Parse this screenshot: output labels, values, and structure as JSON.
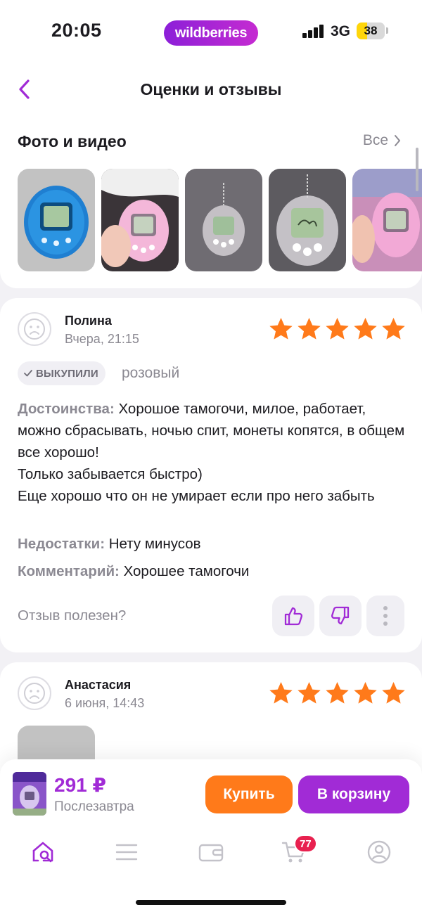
{
  "status_bar": {
    "time": "20:05",
    "brand": "wildberries",
    "network": "3G",
    "battery": "38",
    "battery_level": 0.38
  },
  "header": {
    "title": "Оценки и отзывы",
    "back_icon": "chevron-left-icon"
  },
  "photos": {
    "title": "Фото и видео",
    "all_label": "Все",
    "items": [
      {
        "alt": "blue tamagotchi",
        "color": "#2a7fc9"
      },
      {
        "alt": "pink tamagotchi in hand",
        "color": "#f2b5d6"
      },
      {
        "alt": "clear tamagotchi",
        "color": "#6e6c70"
      },
      {
        "alt": "clear tamagotchi closeup",
        "color": "#5c5a5e"
      },
      {
        "alt": "pink tamagotchi",
        "color": "#e9a6d2"
      }
    ]
  },
  "reviews": [
    {
      "author": "Полина",
      "date": "Вчера, 21:15",
      "rating": 5,
      "badge": "ВЫКУПИЛИ",
      "variant": "розовый",
      "pros_label": "Достоинства:",
      "pros_text": " Хорошое тамогочи, милое, работает, можно сбрасывать, ночью спит, монеты копятся, в общем все хорошо!\nТолько забывается быстро)\nЕще хорошо что он не умирает если про него забыть",
      "cons_label": "Недостатки:",
      "cons_text": " Нету минусов",
      "comment_label": "Комментарий:",
      "comment_text": " Хорошее тамогочи",
      "helpful_label": "Отзыв полезен?"
    },
    {
      "author": "Анастасия",
      "date": "6 июня, 14:43",
      "rating": 5
    }
  ],
  "bottom_bar": {
    "price": "291 ₽",
    "delivery": "Послезавтра",
    "buy_label": "Купить",
    "cart_label": "В корзину",
    "cart_count": "77"
  },
  "colors": {
    "accent": "#a12bd6",
    "star": "#ff7a1a",
    "buy": "#ff7a1a",
    "badge": "#e8214f"
  }
}
